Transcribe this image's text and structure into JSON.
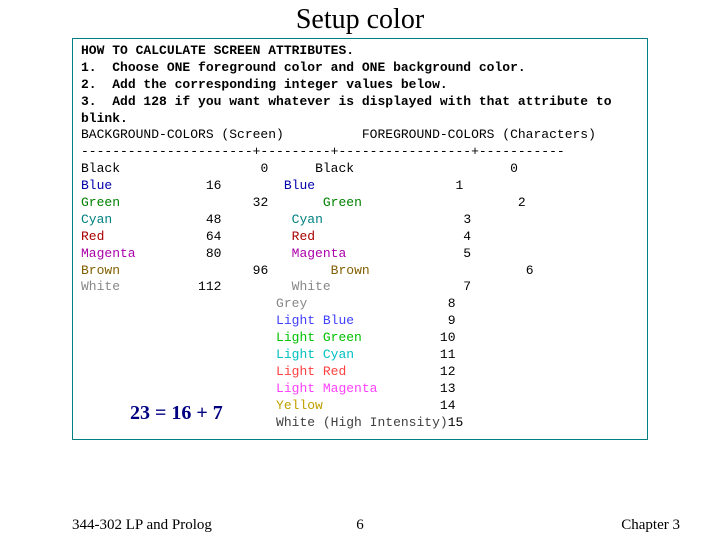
{
  "title": "Setup color",
  "intro": {
    "heading": "HOW TO CALCULATE SCREEN ATTRIBUTES.",
    "step1_num": "1.",
    "step1": "Choose ONE foreground color and ONE background color.",
    "step2_num": "2.",
    "step2": "Add the corresponding integer values below.",
    "step3_num": "3.",
    "step3": "Add 128 if you want whatever is displayed with that attribute to blink."
  },
  "headers": {
    "bg": "BACKGROUND-COLORS (Screen)",
    "fg": "FOREGROUND-COLORS (Characters)",
    "sep": "----------------------+---------+-----------------+-----------"
  },
  "bg_colors": [
    {
      "name": "Black",
      "value": "0"
    },
    {
      "name": "Blue",
      "value": "16"
    },
    {
      "name": "Green",
      "value": "32"
    },
    {
      "name": "Cyan",
      "value": "48"
    },
    {
      "name": "Red",
      "value": "64"
    },
    {
      "name": "Magenta",
      "value": "80"
    },
    {
      "name": "Brown",
      "value": "96"
    },
    {
      "name": "White",
      "value": "112"
    }
  ],
  "fg_colors": [
    {
      "name": "Black",
      "value": "0"
    },
    {
      "name": "Blue",
      "value": "1"
    },
    {
      "name": "Green",
      "value": "2"
    },
    {
      "name": "Cyan",
      "value": "3"
    },
    {
      "name": "Red",
      "value": "4"
    },
    {
      "name": "Magenta",
      "value": "5"
    },
    {
      "name": "Brown",
      "value": "6"
    },
    {
      "name": "White",
      "value": "7"
    },
    {
      "name": "Grey",
      "value": "8"
    },
    {
      "name": "Light Blue",
      "value": "9"
    },
    {
      "name": "Light Green",
      "value": "10"
    },
    {
      "name": "Light Cyan",
      "value": "11"
    },
    {
      "name": "Light Red",
      "value": "12"
    },
    {
      "name": "Light Magenta",
      "value": "13"
    },
    {
      "name": "Yellow",
      "value": "14"
    },
    {
      "name": "White (High Intensity)",
      "value": "15"
    }
  ],
  "equation": "23 = 16 + 7",
  "footer": {
    "left": "344-302 LP and Prolog",
    "center": "6",
    "right": "Chapter 3"
  }
}
